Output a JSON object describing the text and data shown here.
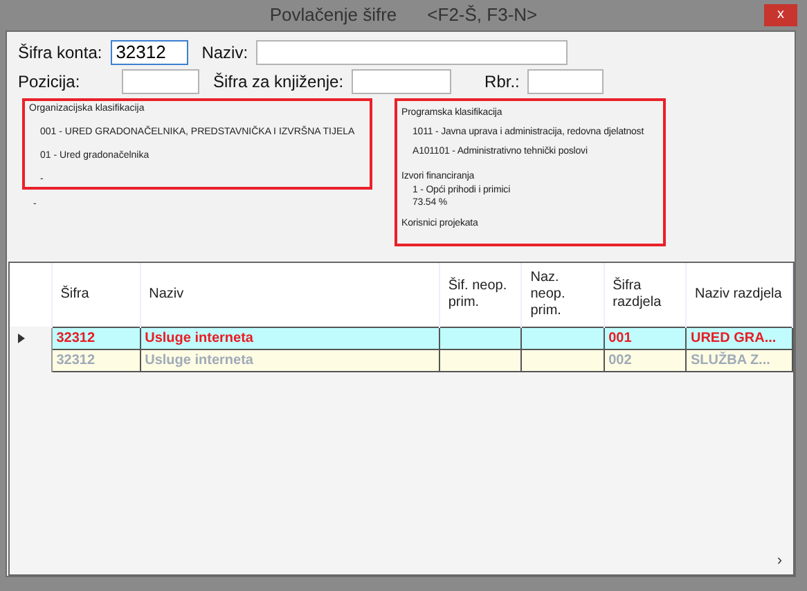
{
  "window": {
    "title": "Povlačenje šifre",
    "shortcuts": "<F2-Š, F3-N>",
    "close": "x"
  },
  "fields": [
    {
      "label": "Šifra konta:",
      "value": "32312",
      "focused": true
    },
    {
      "label": "Naziv:",
      "focused": false
    },
    {
      "label": "Pozicija:",
      "focused": false
    },
    {
      "label": "Šifra za knjiženje:",
      "focused": false
    },
    {
      "label": "Rbr.:",
      "focused": false
    }
  ],
  "org_panel": {
    "title": "Organizacijska klasifikacija",
    "lines": [
      "001 - URED GRADONAČELNIKA, PREDSTAVNIČKA I IZVRŠNA TIJELA",
      "01 - Ured gradonačelnika",
      "-"
    ],
    "below": "-"
  },
  "prog_panel": {
    "title": "Programska klasifikacija",
    "lines": [
      "1011 - Javna uprava i administracija, redovna djelatnost",
      "A101101 - Administrativno tehnički poslovi"
    ],
    "funding_title": "Izvori financiranja",
    "funding_lines": [
      "1 - Opći prihodi i primici",
      "73.54 %"
    ],
    "projects_title": "Korisnici projekata"
  },
  "table": {
    "columns": [
      "Šifra",
      "Naziv",
      "Šif. neop. prim.",
      "Naz. neop. prim.",
      "Šifra razdjela",
      "Naziv razdjela"
    ],
    "rows": [
      {
        "selected": true,
        "cells": [
          "32312",
          "Usluge interneta",
          "",
          "",
          "001",
          "URED GRA..."
        ]
      },
      {
        "selected": false,
        "cells": [
          "32312",
          "Usluge interneta",
          "",
          "",
          "002",
          "SLUŽBA Z..."
        ]
      }
    ]
  },
  "scroll_arrow": "›"
}
